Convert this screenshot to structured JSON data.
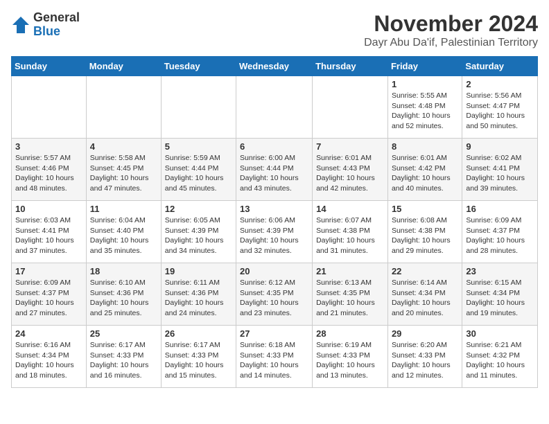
{
  "logo": {
    "general": "General",
    "blue": "Blue"
  },
  "title": "November 2024",
  "subtitle": "Dayr Abu Da'if, Palestinian Territory",
  "weekdays": [
    "Sunday",
    "Monday",
    "Tuesday",
    "Wednesday",
    "Thursday",
    "Friday",
    "Saturday"
  ],
  "weeks": [
    [
      {
        "day": "",
        "info": ""
      },
      {
        "day": "",
        "info": ""
      },
      {
        "day": "",
        "info": ""
      },
      {
        "day": "",
        "info": ""
      },
      {
        "day": "",
        "info": ""
      },
      {
        "day": "1",
        "info": "Sunrise: 5:55 AM\nSunset: 4:48 PM\nDaylight: 10 hours\nand 52 minutes."
      },
      {
        "day": "2",
        "info": "Sunrise: 5:56 AM\nSunset: 4:47 PM\nDaylight: 10 hours\nand 50 minutes."
      }
    ],
    [
      {
        "day": "3",
        "info": "Sunrise: 5:57 AM\nSunset: 4:46 PM\nDaylight: 10 hours\nand 48 minutes."
      },
      {
        "day": "4",
        "info": "Sunrise: 5:58 AM\nSunset: 4:45 PM\nDaylight: 10 hours\nand 47 minutes."
      },
      {
        "day": "5",
        "info": "Sunrise: 5:59 AM\nSunset: 4:44 PM\nDaylight: 10 hours\nand 45 minutes."
      },
      {
        "day": "6",
        "info": "Sunrise: 6:00 AM\nSunset: 4:44 PM\nDaylight: 10 hours\nand 43 minutes."
      },
      {
        "day": "7",
        "info": "Sunrise: 6:01 AM\nSunset: 4:43 PM\nDaylight: 10 hours\nand 42 minutes."
      },
      {
        "day": "8",
        "info": "Sunrise: 6:01 AM\nSunset: 4:42 PM\nDaylight: 10 hours\nand 40 minutes."
      },
      {
        "day": "9",
        "info": "Sunrise: 6:02 AM\nSunset: 4:41 PM\nDaylight: 10 hours\nand 39 minutes."
      }
    ],
    [
      {
        "day": "10",
        "info": "Sunrise: 6:03 AM\nSunset: 4:41 PM\nDaylight: 10 hours\nand 37 minutes."
      },
      {
        "day": "11",
        "info": "Sunrise: 6:04 AM\nSunset: 4:40 PM\nDaylight: 10 hours\nand 35 minutes."
      },
      {
        "day": "12",
        "info": "Sunrise: 6:05 AM\nSunset: 4:39 PM\nDaylight: 10 hours\nand 34 minutes."
      },
      {
        "day": "13",
        "info": "Sunrise: 6:06 AM\nSunset: 4:39 PM\nDaylight: 10 hours\nand 32 minutes."
      },
      {
        "day": "14",
        "info": "Sunrise: 6:07 AM\nSunset: 4:38 PM\nDaylight: 10 hours\nand 31 minutes."
      },
      {
        "day": "15",
        "info": "Sunrise: 6:08 AM\nSunset: 4:38 PM\nDaylight: 10 hours\nand 29 minutes."
      },
      {
        "day": "16",
        "info": "Sunrise: 6:09 AM\nSunset: 4:37 PM\nDaylight: 10 hours\nand 28 minutes."
      }
    ],
    [
      {
        "day": "17",
        "info": "Sunrise: 6:09 AM\nSunset: 4:37 PM\nDaylight: 10 hours\nand 27 minutes."
      },
      {
        "day": "18",
        "info": "Sunrise: 6:10 AM\nSunset: 4:36 PM\nDaylight: 10 hours\nand 25 minutes."
      },
      {
        "day": "19",
        "info": "Sunrise: 6:11 AM\nSunset: 4:36 PM\nDaylight: 10 hours\nand 24 minutes."
      },
      {
        "day": "20",
        "info": "Sunrise: 6:12 AM\nSunset: 4:35 PM\nDaylight: 10 hours\nand 23 minutes."
      },
      {
        "day": "21",
        "info": "Sunrise: 6:13 AM\nSunset: 4:35 PM\nDaylight: 10 hours\nand 21 minutes."
      },
      {
        "day": "22",
        "info": "Sunrise: 6:14 AM\nSunset: 4:34 PM\nDaylight: 10 hours\nand 20 minutes."
      },
      {
        "day": "23",
        "info": "Sunrise: 6:15 AM\nSunset: 4:34 PM\nDaylight: 10 hours\nand 19 minutes."
      }
    ],
    [
      {
        "day": "24",
        "info": "Sunrise: 6:16 AM\nSunset: 4:34 PM\nDaylight: 10 hours\nand 18 minutes."
      },
      {
        "day": "25",
        "info": "Sunrise: 6:17 AM\nSunset: 4:33 PM\nDaylight: 10 hours\nand 16 minutes."
      },
      {
        "day": "26",
        "info": "Sunrise: 6:17 AM\nSunset: 4:33 PM\nDaylight: 10 hours\nand 15 minutes."
      },
      {
        "day": "27",
        "info": "Sunrise: 6:18 AM\nSunset: 4:33 PM\nDaylight: 10 hours\nand 14 minutes."
      },
      {
        "day": "28",
        "info": "Sunrise: 6:19 AM\nSunset: 4:33 PM\nDaylight: 10 hours\nand 13 minutes."
      },
      {
        "day": "29",
        "info": "Sunrise: 6:20 AM\nSunset: 4:33 PM\nDaylight: 10 hours\nand 12 minutes."
      },
      {
        "day": "30",
        "info": "Sunrise: 6:21 AM\nSunset: 4:32 PM\nDaylight: 10 hours\nand 11 minutes."
      }
    ]
  ]
}
